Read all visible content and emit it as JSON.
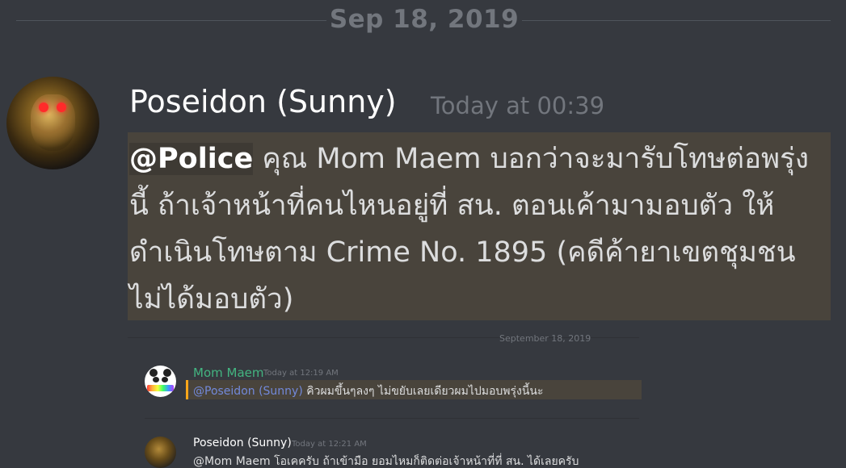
{
  "divider": {
    "date": "Sep 18, 2019"
  },
  "message": {
    "author": "Poseidon (Sunny)",
    "timestamp": "Today at 00:39",
    "mention": "@Police",
    "text": " คุณ Mom Maem บอกว่าจะมารับโทษต่อพรุ่งนี้ ถ้าเจ้าหน้าที่คนไหนอยู่ที่ สน. ตอนเค้ามามอบตัว ให้ดำเนินโทษตาม Crime No. 1895 (คดีค้ายาเขตชุมชนไม่ได้มอบตัว)"
  },
  "embed": {
    "top_date": "September 18, 2019",
    "msg1": {
      "author": "Mom Maem",
      "time": "Today at 12:19 AM",
      "mention": "@Poseidon (Sunny)",
      "text": " คิวผมขึ้นๆลงๆ ไม่ขยับเลยเดียวผมไปมอบพรุ่งนี้นะ"
    },
    "msg2": {
      "author": "Poseidon (Sunny)",
      "time": "Today at 12:21 AM",
      "text": "@Mom Maem โอเคครับ ถ้าเข้ามือ ยอมไหมก็ติดต่อเจ้าหน้าที่ที่ สน. ได้เลยครับ"
    }
  },
  "colors": {
    "background": "#36393f",
    "highlight": "#49443c",
    "username_green": "#43b581",
    "mention_blue": "#7289da",
    "mention_bar": "#faa61a"
  }
}
